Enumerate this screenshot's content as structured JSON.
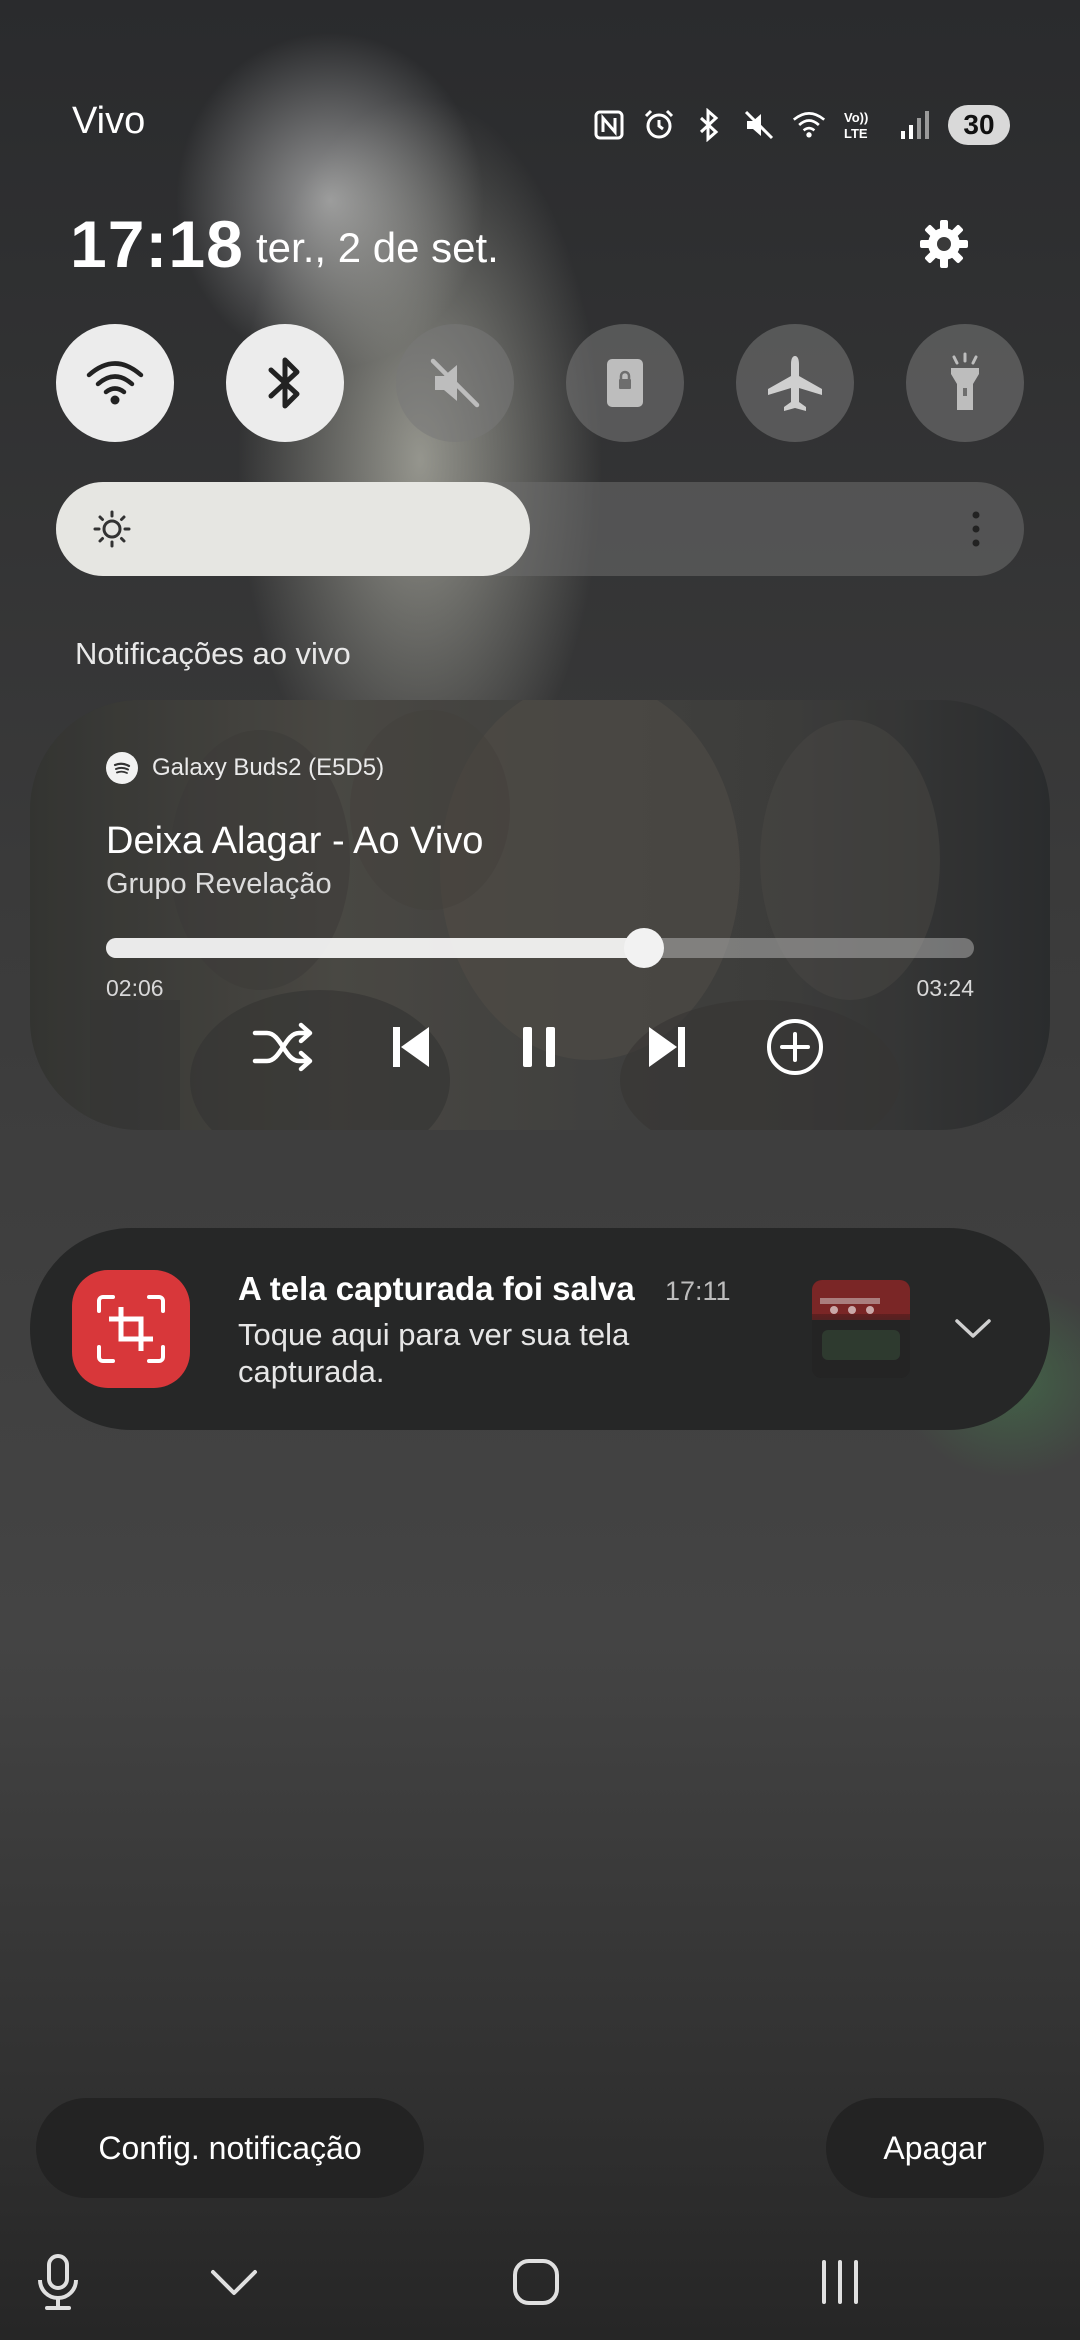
{
  "status_bar": {
    "carrier": "Vivo",
    "icons": [
      "nfc-icon",
      "alarm-icon",
      "bluetooth-icon",
      "mute-icon",
      "wifi-icon",
      "volte-icon",
      "signal-icon"
    ],
    "volte_label": "Vo)) LTE",
    "battery_level": "30"
  },
  "header": {
    "time": "17:18",
    "date": "ter., 2 de set."
  },
  "quick_toggles": [
    {
      "name": "wifi",
      "icon": "wifi-icon",
      "active": true
    },
    {
      "name": "bluetooth",
      "icon": "bluetooth-icon",
      "active": true
    },
    {
      "name": "sound",
      "icon": "mute-icon",
      "active": false
    },
    {
      "name": "rotation-lock",
      "icon": "lock-icon",
      "active": false
    },
    {
      "name": "airplane",
      "icon": "airplane-icon",
      "active": false
    },
    {
      "name": "flashlight",
      "icon": "flashlight-icon",
      "active": false
    }
  ],
  "brightness": {
    "level": 0.49
  },
  "live_section": {
    "title": "Notificações ao vivo"
  },
  "media": {
    "source_app_icon": "spotify-icon",
    "output_device": "Galaxy Buds2 (E5D5)",
    "title": "Deixa Alagar - Ao Vivo",
    "artist": "Grupo Revelação",
    "elapsed": "02:06",
    "duration": "03:24",
    "progress": 0.62,
    "controls": [
      "shuffle-icon",
      "previous-icon",
      "pause-icon",
      "next-icon",
      "add-icon"
    ]
  },
  "notification": {
    "app_icon": "screenshot-icon",
    "title": "A tela capturada foi salva",
    "time": "17:11",
    "body": "Toque aqui para ver sua tela capturada.",
    "expand_icon": "chevron-down-icon"
  },
  "footer": {
    "settings_label": "Config. notificação",
    "clear_label": "Apagar"
  },
  "nav_bar": [
    "microphone-icon",
    "collapse-icon",
    "home-icon",
    "recents-icon"
  ],
  "colors": {
    "toggle_on": "#ececec",
    "toggle_off": "#6e6e6e",
    "screenshot_app": "#d8373a",
    "card_bg": "#262727"
  }
}
